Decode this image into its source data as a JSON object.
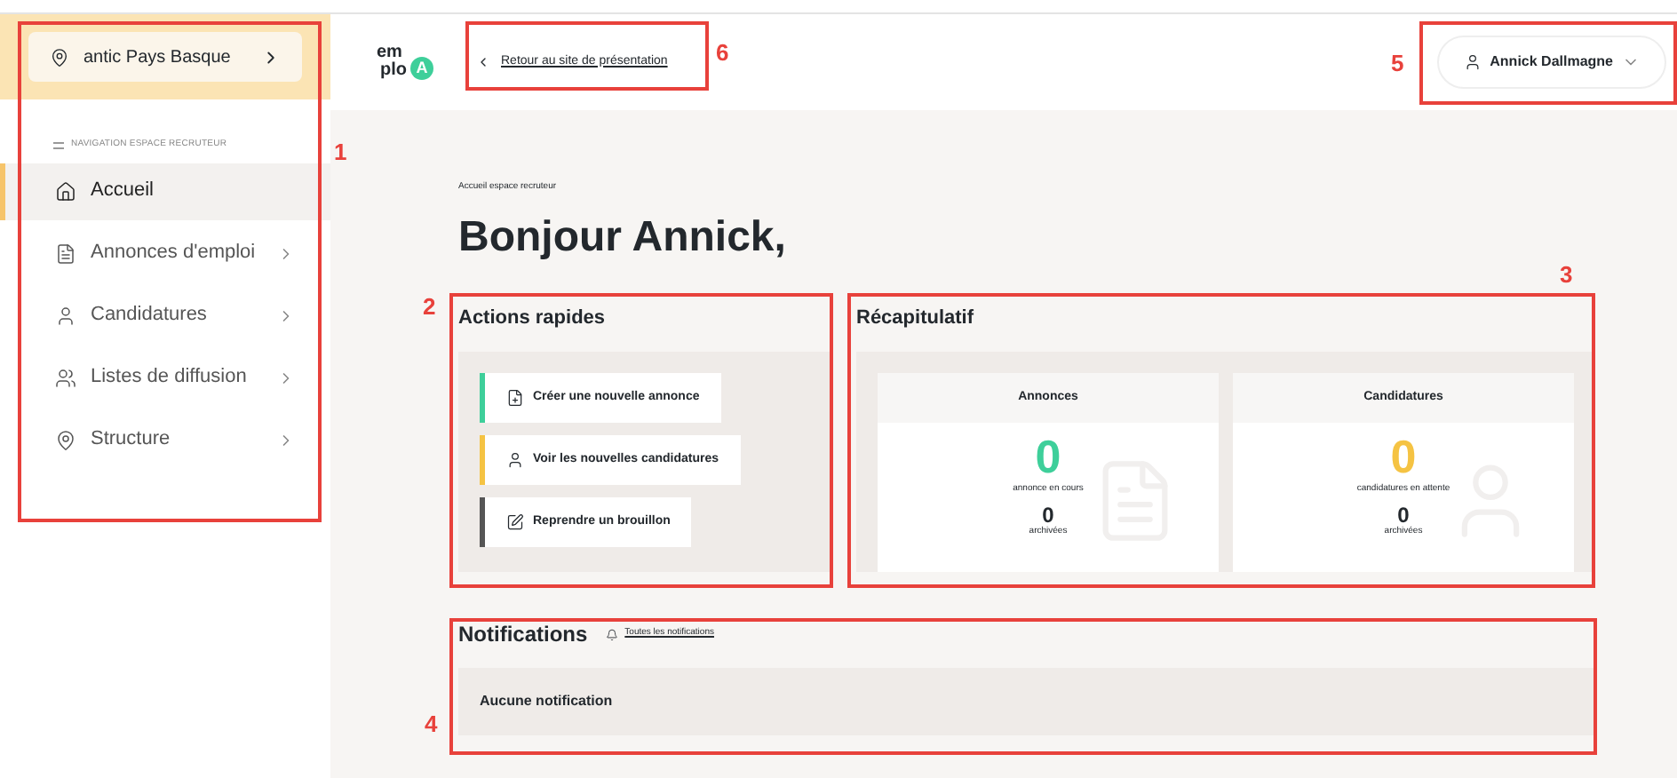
{
  "sidebar": {
    "location": "antic Pays Basque",
    "nav_label": "NAVIGATION ESPACE RECRUTEUR",
    "items": [
      {
        "label": "Accueil",
        "selected": true,
        "expandable": false
      },
      {
        "label": "Annonces d'emploi",
        "selected": false,
        "expandable": true
      },
      {
        "label": "Candidatures",
        "selected": false,
        "expandable": true
      },
      {
        "label": "Listes de diffusion",
        "selected": false,
        "expandable": true
      },
      {
        "label": "Structure",
        "selected": false,
        "expandable": true
      }
    ]
  },
  "header": {
    "logo": [
      "em",
      "plo",
      "A"
    ],
    "back_link": "Retour au site de présentation",
    "user": "Annick Dallmagne"
  },
  "breadcrumb": "Accueil espace recruteur",
  "title": "Bonjour Annick,",
  "quick_actions": {
    "title": "Actions rapides",
    "items": [
      {
        "label": "Créer une nouvelle annonce",
        "color": "#3ecf9a"
      },
      {
        "label": "Voir les nouvelles candidatures",
        "color": "#f5c343"
      },
      {
        "label": "Reprendre un brouillon",
        "color": "#555555"
      }
    ]
  },
  "summary": {
    "title": "Récapitulatif",
    "cards": [
      {
        "title": "Annonces",
        "count": "0",
        "count_label": "annonce en cours",
        "archived": "0",
        "archived_label": "archivées",
        "color": "#3ecf9a"
      },
      {
        "title": "Candidatures",
        "count": "0",
        "count_label": "candidatures en attente",
        "archived": "0",
        "archived_label": "archivées",
        "color": "#f5c343"
      }
    ]
  },
  "notifications": {
    "title": "Notifications",
    "link": "Toutes les notifications",
    "empty": "Aucune notification"
  },
  "annotations": [
    {
      "label": "1"
    },
    {
      "label": "2"
    },
    {
      "label": "3"
    },
    {
      "label": "4"
    },
    {
      "label": "5"
    },
    {
      "label": "6"
    }
  ]
}
